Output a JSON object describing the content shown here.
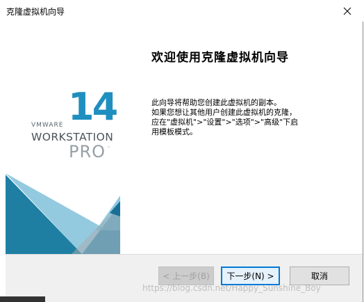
{
  "window": {
    "title": "克隆虚拟机向导"
  },
  "branding": {
    "vmware": "VMWARE",
    "version": "14",
    "product": "WORKSTATION",
    "edition": "PRO",
    "tm": "™",
    "colors": {
      "accent_blue": "#1f8fbf",
      "dark_text": "#4c5358",
      "light_text": "#97a0a6"
    }
  },
  "content": {
    "heading": "欢迎使用克隆虚拟机向导",
    "description_lines": [
      "此向导将帮助您创建此虚拟机的副本。",
      "如果您想让其他用户创建此虚拟机的克隆，",
      "应在\"虚拟机\">\"设置\">\"选项\">\"高级\"下启",
      "用模板模式。"
    ]
  },
  "buttons": {
    "back": "< 上一步(B)",
    "next": "下一步(N) >",
    "cancel": "取消"
  },
  "watermark": "https://blog.csdn.net/Happy_Sunshine_Boy"
}
